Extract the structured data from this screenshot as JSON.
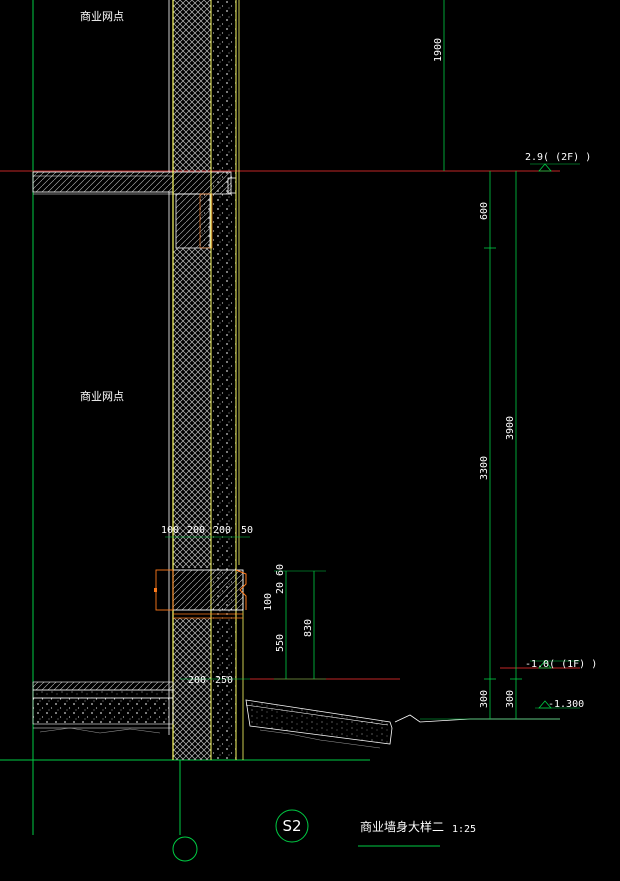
{
  "rooms": {
    "upper_label": "商业网点",
    "lower_label": "商业网点"
  },
  "dims_right": {
    "d1900": "1900",
    "d600": "600",
    "d3300": "3300",
    "d3900": "3900",
    "d300a": "300",
    "d300b": "300"
  },
  "levels": {
    "l2f": "2.9( (2F) )",
    "l1f": "-1.0( (1F) )",
    "lg": "-1.300"
  },
  "wall_dims": {
    "d100": "100",
    "d200a": "200",
    "d200b": "200",
    "d50": "50"
  },
  "base_dims": {
    "d20": "20",
    "d60": "60",
    "d100": "100",
    "d550": "550",
    "d830": "830",
    "d200": "200",
    "d250": "250"
  },
  "title": {
    "mark": "S2",
    "name": "商业墙身大样二",
    "scale": "1:25"
  },
  "colors": {
    "background": "#000000",
    "wall_line": "#ffff66",
    "hatch": "#bbbbbb",
    "dim_line": "#00cc44",
    "level_line": "#ff3333",
    "orange": "#ff7a1a",
    "text": "#ffffff"
  }
}
